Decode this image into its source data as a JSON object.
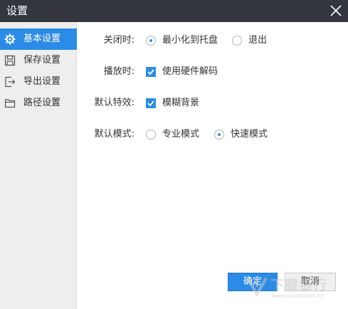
{
  "window": {
    "title": "设置",
    "close_icon": "close-icon"
  },
  "sidebar": {
    "items": [
      {
        "label": "基本设置",
        "icon": "gear-icon",
        "active": true
      },
      {
        "label": "保存设置",
        "icon": "save-icon",
        "active": false
      },
      {
        "label": "导出设置",
        "icon": "export-icon",
        "active": false
      },
      {
        "label": "路径设置",
        "icon": "folder-icon",
        "active": false
      }
    ]
  },
  "settings": {
    "close_action": {
      "label": "关闭时:",
      "options": [
        {
          "text": "最小化到托盘",
          "selected": true
        },
        {
          "text": "退出",
          "selected": false
        }
      ]
    },
    "playback": {
      "label": "播放时:",
      "option": {
        "text": "使用硬件解码",
        "checked": true
      }
    },
    "default_effect": {
      "label": "默认特效:",
      "option": {
        "text": "模糊背景",
        "checked": true
      }
    },
    "default_mode": {
      "label": "默认模式:",
      "options": [
        {
          "text": "专业模式",
          "selected": false
        },
        {
          "text": "快速模式",
          "selected": true
        }
      ]
    }
  },
  "buttons": {
    "ok": "确定",
    "cancel": "取消"
  },
  "watermark": {
    "name": "下载银行",
    "url": "www.downbank.cn"
  },
  "colors": {
    "titlebar": "#34363d",
    "accent": "#2c8be6",
    "sidebar_bg": "#eeeeee"
  }
}
